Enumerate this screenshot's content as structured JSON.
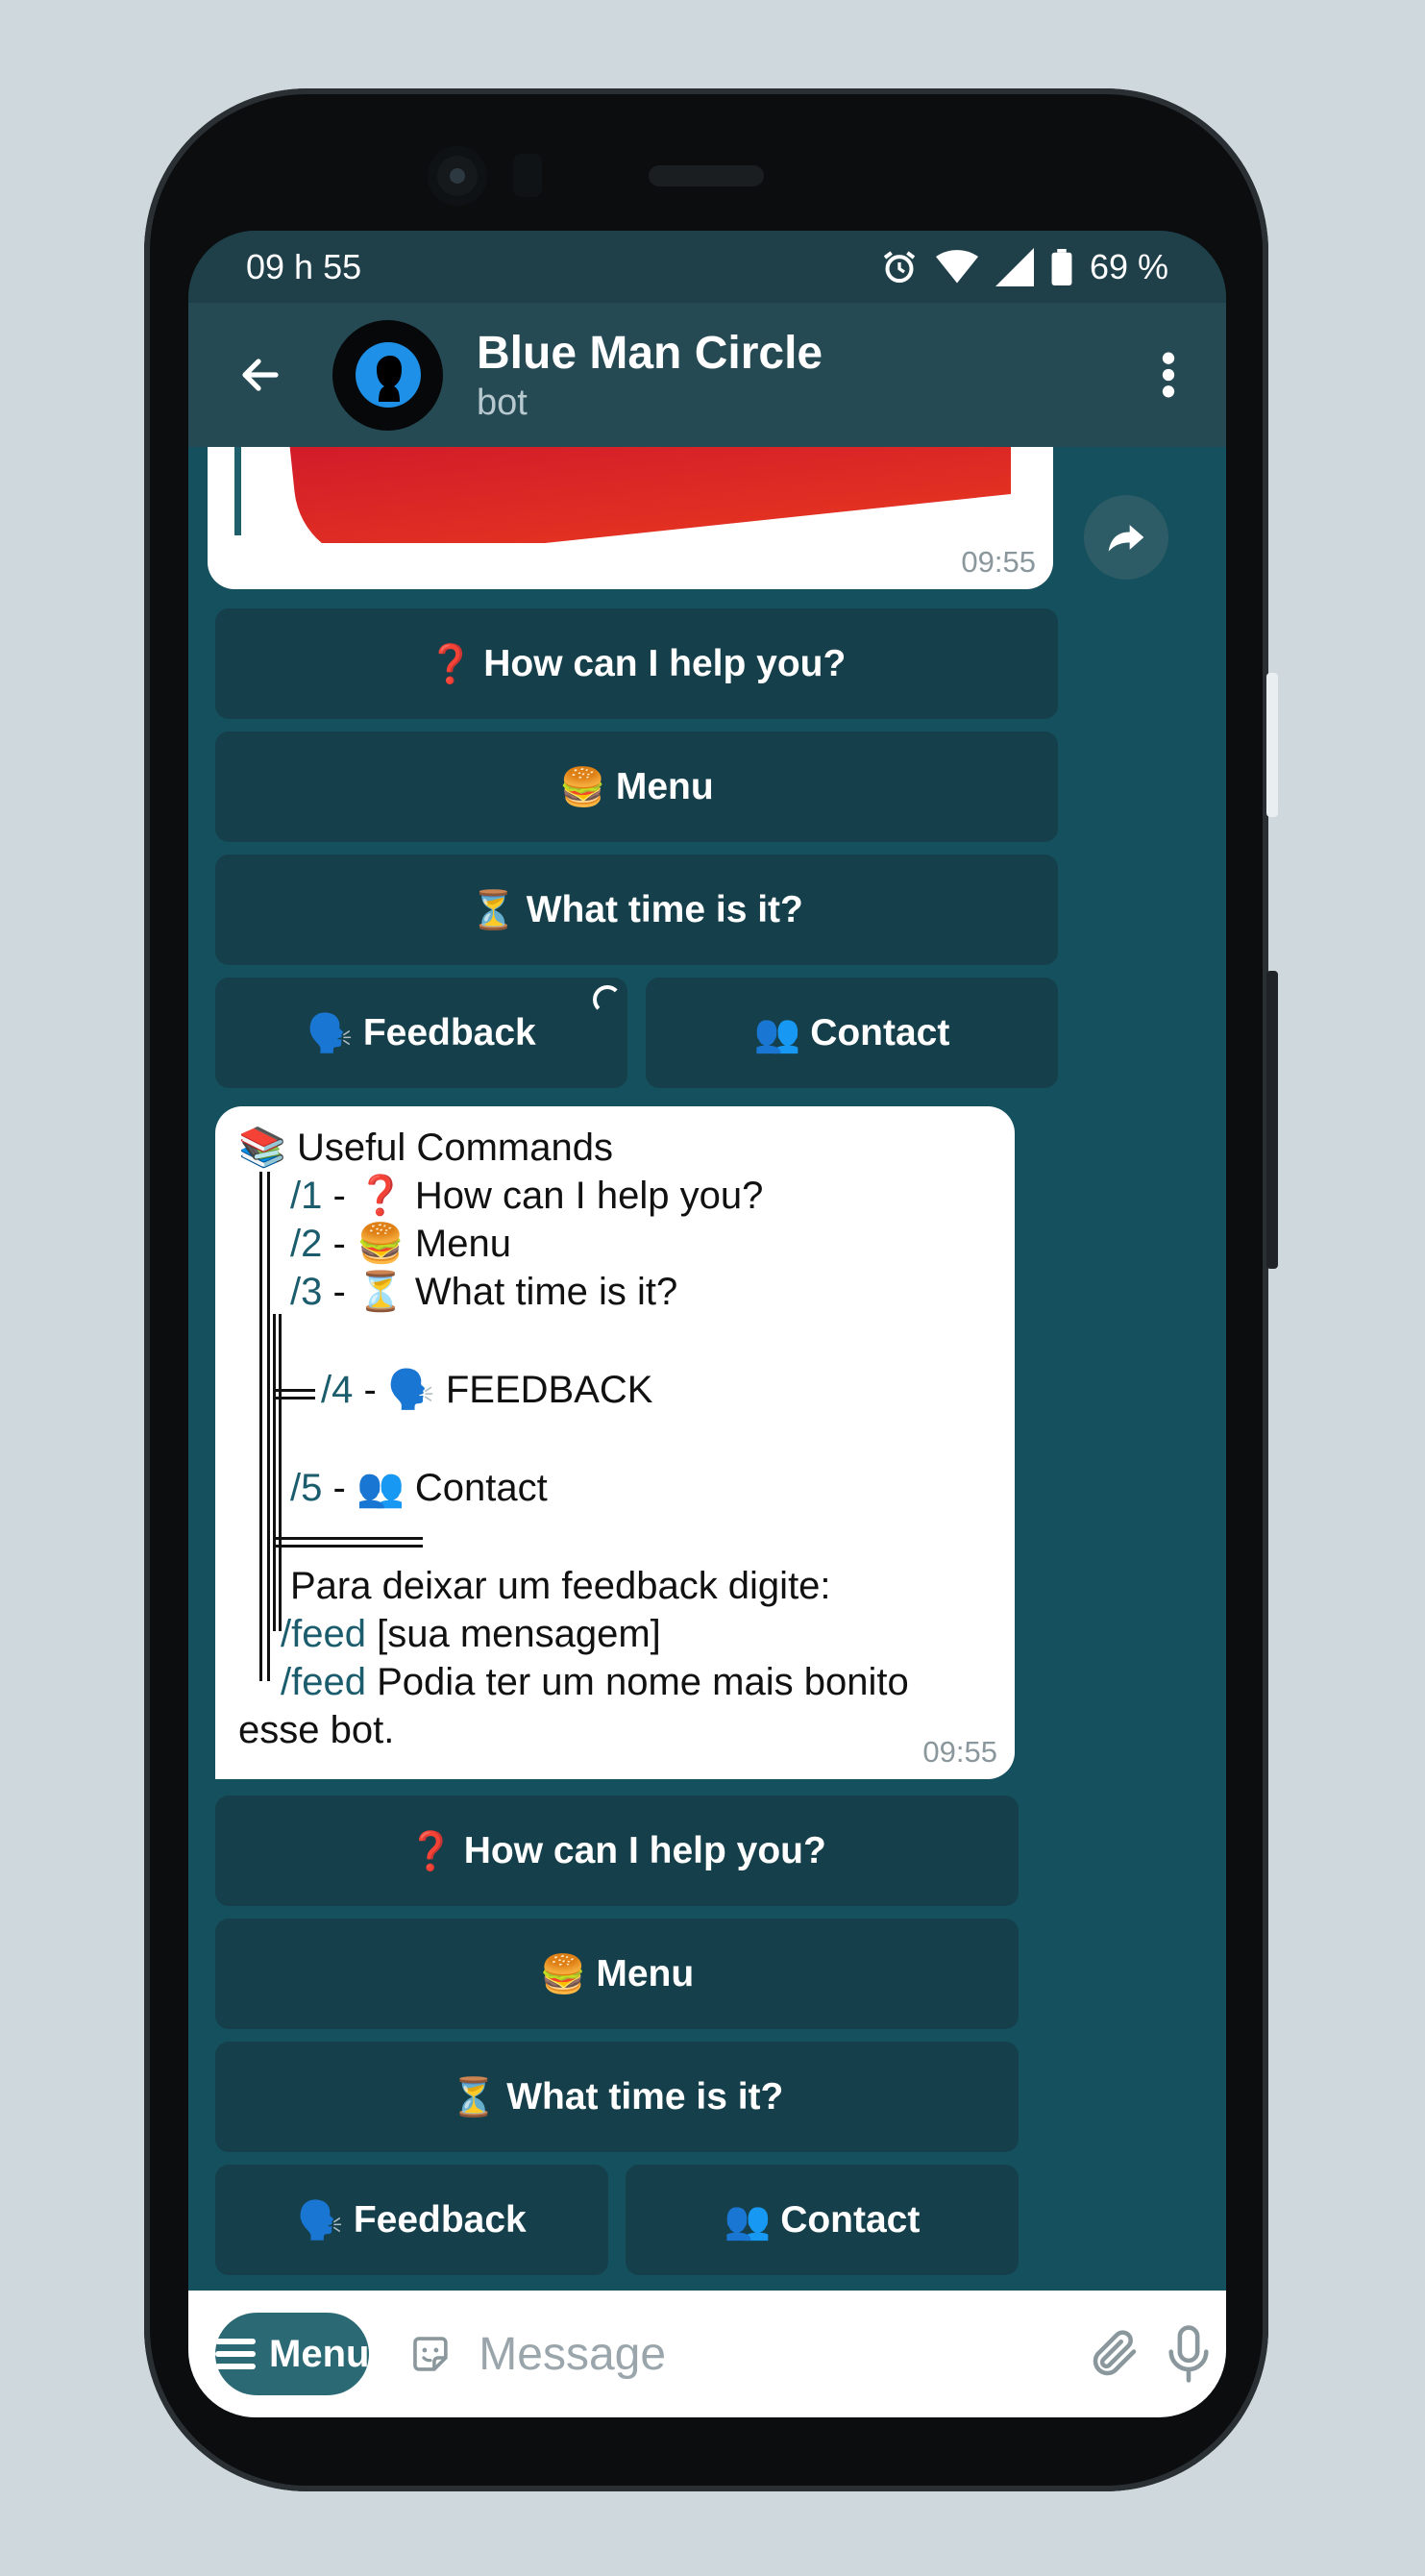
{
  "status_bar": {
    "time": "09 h 55",
    "battery": "69 %"
  },
  "header": {
    "title": "Blue Man Circle",
    "subtitle": "bot"
  },
  "messages": {
    "first": {
      "time": "09:55"
    },
    "commands": {
      "heading_emoji": "📚",
      "heading": "Useful Commands",
      "items": [
        {
          "cmd": "/1",
          "sep": "-",
          "emoji": "❓",
          "text": "How can I help you?"
        },
        {
          "cmd": "/2",
          "sep": "-",
          "emoji": "🍔",
          "text": "Menu"
        },
        {
          "cmd": "/3",
          "sep": "-",
          "emoji": "⏳",
          "text": "What time is it?"
        },
        {
          "cmd": "/4",
          "sep": "-",
          "emoji": "🗣️",
          "text": "FEEDBACK"
        },
        {
          "cmd": "/5",
          "sep": "-",
          "emoji": "👥",
          "text": "Contact"
        }
      ],
      "feedback_intro": "Para deixar um feedback digite:",
      "feed_cmd": "/feed",
      "feed_example1": "[sua mensagem]",
      "feed_example2": "Podia ter um nome mais bonito",
      "feed_example2_cont": "esse bot.",
      "time": "09:55"
    }
  },
  "keyboard_top": [
    {
      "emoji": "❓",
      "label": "How can I help you?"
    },
    {
      "emoji": "🍔",
      "label": "Menu"
    },
    {
      "emoji": "⏳",
      "label": "What time is it?"
    },
    {
      "emoji": "🗣️",
      "label": "Feedback"
    },
    {
      "emoji": "👥",
      "label": "Contact"
    }
  ],
  "keyboard_bottom": [
    {
      "emoji": "❓",
      "label": "How can I help you?"
    },
    {
      "emoji": "🍔",
      "label": "Menu"
    },
    {
      "emoji": "⏳",
      "label": "What time is it?"
    },
    {
      "emoji": "🗣️",
      "label": "Feedback"
    },
    {
      "emoji": "👥",
      "label": "Contact"
    }
  ],
  "input": {
    "menu_label": "Menu",
    "placeholder": "Message"
  },
  "colors": {
    "chat_background": "#14505d",
    "keyboard_button": "#153f4a",
    "header": "#264a54",
    "menu_button": "#2b6a74"
  }
}
